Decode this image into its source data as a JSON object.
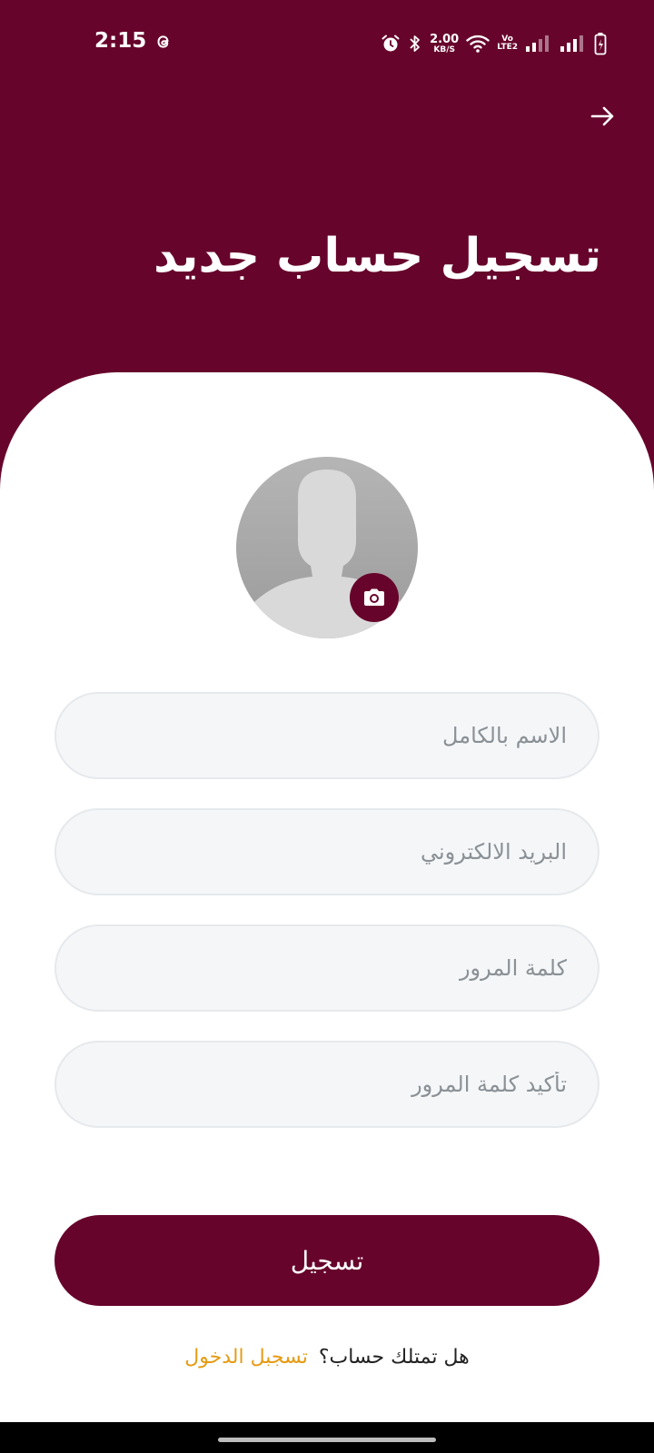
{
  "status_bar": {
    "time": "2:15",
    "net_speed_value": "2.00",
    "net_speed_unit": "KB/S",
    "volte_top": "Vo",
    "volte_bottom": "LTE2",
    "icons": [
      "threads-icon",
      "alarm-icon",
      "bluetooth-icon",
      "wifi-icon",
      "signal-icon",
      "signal-icon",
      "battery-charging-icon"
    ]
  },
  "header": {
    "title": "تسجيل حساب جديد",
    "nav_icon": "arrow-right-icon"
  },
  "avatar": {
    "icon": "person-silhouette-icon",
    "camera_icon": "camera-icon"
  },
  "form": {
    "full_name_placeholder": "الاسم بالكامل",
    "email_placeholder": "البريد الالكتروني",
    "password_placeholder": "كلمة المرور",
    "confirm_password_placeholder": "تأكيد كلمة المرور",
    "full_name_value": "",
    "email_value": "",
    "password_value": "",
    "confirm_password_value": "",
    "submit_label": "تسجيل"
  },
  "footer": {
    "question": "هل تمتلك حساب؟",
    "login_link": "تسجبل الدخول"
  },
  "colors": {
    "primary": "#67042b",
    "accent_link": "#e69b14",
    "input_background": "#f5f6f8"
  }
}
